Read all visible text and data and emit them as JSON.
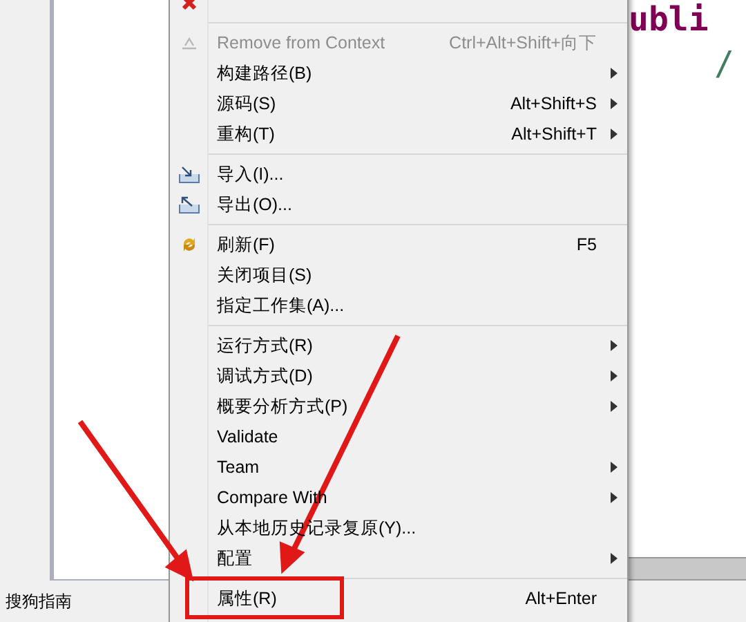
{
  "editor": {
    "code_fragment": "ubli",
    "comment_fragment": "/"
  },
  "menu": {
    "groups": [
      [
        {
          "label": "Remove from Context",
          "shortcut": "Ctrl+Alt+Shift+向下",
          "submenu": false,
          "disabled": true
        },
        {
          "label": "构建路径(B)",
          "submenu": true,
          "disabled": false
        },
        {
          "label": "源码(S)",
          "shortcut": "Alt+Shift+S",
          "submenu": true,
          "disabled": false
        },
        {
          "label": "重构(T)",
          "shortcut": "Alt+Shift+T",
          "submenu": true,
          "disabled": false
        }
      ],
      [
        {
          "label": "导入(I)...",
          "submenu": false,
          "disabled": false
        },
        {
          "label": "导出(O)...",
          "submenu": false,
          "disabled": false
        }
      ],
      [
        {
          "label": "刷新(F)",
          "shortcut": "F5",
          "submenu": false,
          "disabled": false
        },
        {
          "label": "关闭项目(S)",
          "submenu": false,
          "disabled": false
        },
        {
          "label": "指定工作集(A)...",
          "submenu": false,
          "disabled": false
        }
      ],
      [
        {
          "label": "运行方式(R)",
          "submenu": true,
          "disabled": false
        },
        {
          "label": "调试方式(D)",
          "submenu": true,
          "disabled": false
        },
        {
          "label": "概要分析方式(P)",
          "submenu": true,
          "disabled": false
        },
        {
          "label": "Validate",
          "submenu": false,
          "disabled": false
        },
        {
          "label": "Team",
          "submenu": true,
          "disabled": false
        },
        {
          "label": "Compare With",
          "submenu": true,
          "disabled": false
        },
        {
          "label": "从本地历史记录复原(Y)...",
          "submenu": false,
          "disabled": false
        },
        {
          "label": "配置",
          "submenu": true,
          "disabled": false
        }
      ],
      [
        {
          "label": "属性(R)",
          "shortcut": "Alt+Enter",
          "submenu": false,
          "disabled": false
        }
      ]
    ]
  },
  "status_bar": {
    "text": "搜狗指南"
  }
}
